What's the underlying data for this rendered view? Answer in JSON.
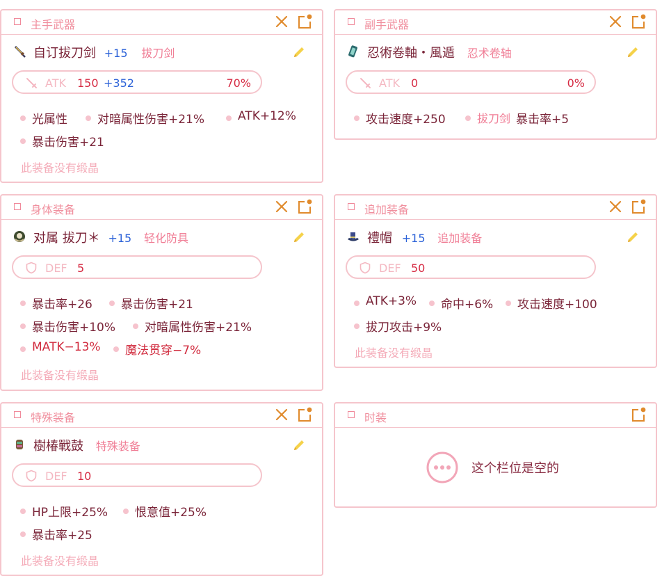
{
  "cards": {
    "main_weapon": {
      "slot": "主手武器",
      "item": {
        "name": "自订拔刀剑",
        "refine": "+15",
        "type": "拔刀剑"
      },
      "stat": {
        "label": "ATK",
        "base": "150",
        "plus": "+352",
        "percent": "70%"
      },
      "attrs": [
        "光属性",
        "对暗属性伤害+21%",
        "ATK+12%",
        "暴击伤害+21"
      ],
      "note": "此装备没有缎晶"
    },
    "sub_weapon": {
      "slot": "副手武器",
      "item": {
        "name": "忍術卷軸・風遁",
        "type": "忍术卷轴"
      },
      "stat": {
        "label": "ATK",
        "base": "0",
        "percent": "0%"
      },
      "attrs": [
        "攻击速度+250",
        "拔刀剑",
        "暴击率+5"
      ]
    },
    "body": {
      "slot": "身体装备",
      "item": {
        "name": "对属 拔刀＊",
        "refine": "+15",
        "type": "轻化防具"
      },
      "stat": {
        "label": "DEF",
        "base": "5"
      },
      "attrs": [
        "暴击率+26",
        "暴击伤害+21",
        "暴击伤害+10%",
        "对暗属性伤害+21%",
        "MATK−13%",
        "魔法贯穿−7%"
      ],
      "note": "此装备没有缎晶"
    },
    "additional": {
      "slot": "追加装备",
      "item": {
        "name": "禮帽",
        "refine": "+15",
        "type": "追加装备"
      },
      "stat": {
        "label": "DEF",
        "base": "50"
      },
      "attrs": [
        "ATK+3%",
        "命中+6%",
        "攻击速度+100",
        "拔刀攻击+9%"
      ],
      "note": "此装备没有缎晶"
    },
    "special": {
      "slot": "特殊装备",
      "item": {
        "name": "樹椿戰鼓",
        "type": "特殊装备"
      },
      "stat": {
        "label": "DEF",
        "base": "10"
      },
      "attrs": [
        "HP上限+25%",
        "恨意值+25%",
        "暴击率+25"
      ],
      "note": "此装备没有缎晶"
    },
    "fashion": {
      "slot": "时装",
      "empty_text": "这个栏位是空的"
    }
  },
  "colors": {
    "border": "#f5c5cc",
    "accent_orange": "#e08a2c",
    "text_dark": "#7a2438",
    "stat_red": "#d62b43",
    "refine_blue": "#2d63d8"
  },
  "icons": {
    "close": "close-x-icon",
    "edit_slot": "edit-slot-icon",
    "pencil": "pencil-icon",
    "sword": "sword-icon",
    "shield": "shield-icon",
    "more": "ellipsis-icon"
  }
}
